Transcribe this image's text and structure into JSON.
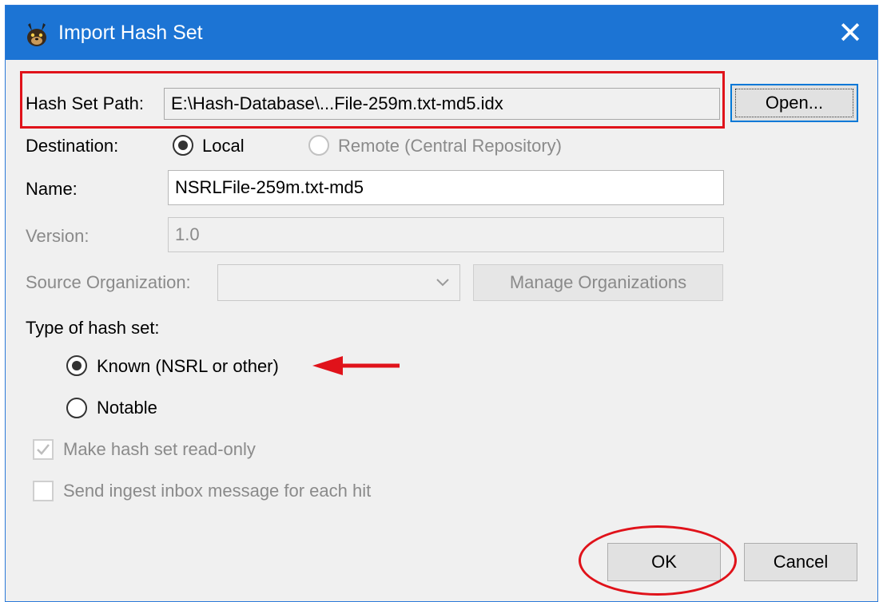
{
  "window": {
    "title": "Import Hash Set"
  },
  "hash_set_path": {
    "label": "Hash Set Path:",
    "value": "E:\\Hash-Database\\...File-259m.txt-md5.idx"
  },
  "open_button": "Open...",
  "destination": {
    "label": "Destination:",
    "local": "Local",
    "remote": "Remote (Central Repository)",
    "selected": "Local"
  },
  "name": {
    "label": "Name:",
    "value": "NSRLFile-259m.txt-md5"
  },
  "version": {
    "label": "Version:",
    "value": "1.0"
  },
  "source_org": {
    "label": "Source Organization:",
    "value": "",
    "manage_button": "Manage Organizations"
  },
  "hash_type": {
    "label": "Type of hash set:",
    "known": "Known (NSRL or other)",
    "notable": "Notable",
    "selected": "Known (NSRL or other)"
  },
  "options": {
    "read_only": {
      "label": "Make hash set read-only",
      "checked": true
    },
    "ingest_inbox": {
      "label": "Send ingest inbox message for each hit",
      "checked": false
    }
  },
  "buttons": {
    "ok": "OK",
    "cancel": "Cancel"
  },
  "colors": {
    "title_bar": "#1c74d4",
    "annotation": "#e0121a"
  }
}
